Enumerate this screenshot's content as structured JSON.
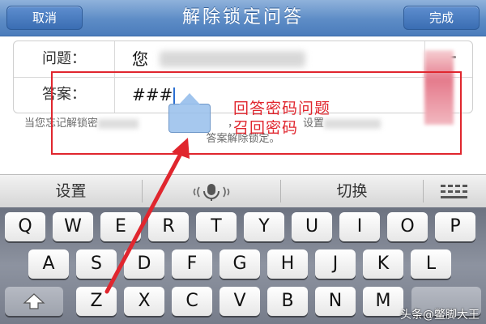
{
  "nav": {
    "cancel_label": "取消",
    "title": "解除锁定问答",
    "done_label": "完成"
  },
  "form": {
    "question_label": "问题：",
    "question_value": "您",
    "answer_label": "答案：",
    "answer_value": "###"
  },
  "hint": {
    "line1_prefix": "当您忘记解锁密",
    "line1_mid": "，",
    "line1_suffix": "设置",
    "line2": "答案解除锁定。"
  },
  "annotation": {
    "line1": "回答密码问题",
    "line2": "召回密码"
  },
  "keyboard_bar": {
    "settings_label": "设置",
    "switch_label": "切换",
    "mic_icon": "microphone-icon",
    "menu_icon": "menu-grid-icon"
  },
  "keyboard": {
    "row1": [
      "Q",
      "W",
      "E",
      "R",
      "T",
      "Y",
      "U",
      "I",
      "O",
      "P"
    ],
    "row2": [
      "A",
      "S",
      "D",
      "F",
      "G",
      "H",
      "J",
      "K",
      "L"
    ],
    "row3": [
      "Z",
      "X",
      "C",
      "V",
      "B",
      "N",
      "M"
    ],
    "shift_icon": "shift-arrow-icon"
  },
  "watermark": "头条@鳖脚大王",
  "colors": {
    "nav_blue": "#5d8cc6",
    "annotation_red": "#e0262e"
  }
}
